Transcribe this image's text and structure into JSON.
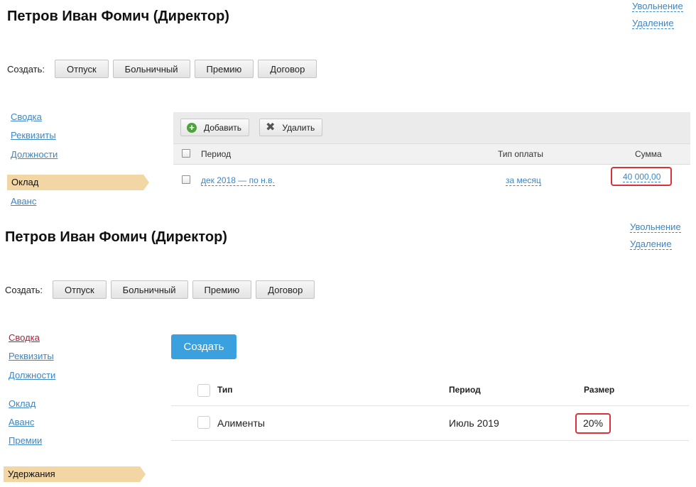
{
  "colors": {
    "accent": "#3aa0de",
    "link": "#3f86c4",
    "highlight": "#d9323b",
    "active_tab": "#f2d6a3"
  },
  "screen1": {
    "title": "Петров Иван Фомич (Директор)",
    "links": {
      "dismissal": "Увольнение",
      "delete": "Удаление"
    },
    "create": {
      "label": "Создать:",
      "buttons": [
        "Отпуск",
        "Больничный",
        "Премию",
        "Договор"
      ]
    },
    "nav": {
      "items": [
        "Сводка",
        "Реквизиты",
        "Должности"
      ],
      "active": "Оклад",
      "after": [
        "Аванс"
      ]
    },
    "toolbar": {
      "add": "Добавить",
      "delete": "Удалить"
    },
    "table": {
      "headers": {
        "period": "Период",
        "pay_type": "Тип оплаты",
        "amount": "Сумма"
      },
      "rows": [
        {
          "period": "дек 2018 — по н.в.",
          "pay_type": "за месяц",
          "amount": "40 000,00"
        }
      ]
    }
  },
  "screen2": {
    "title": "Петров Иван Фомич (Директор)",
    "links": {
      "dismissal": "Увольнение",
      "delete": "Удаление"
    },
    "create": {
      "label": "Создать:",
      "buttons": [
        "Отпуск",
        "Больничный",
        "Премию",
        "Договор"
      ]
    },
    "nav": {
      "group1": [
        "Сводка",
        "Реквизиты",
        "Должности"
      ],
      "group2": [
        "Оклад",
        "Аванс",
        "Премии"
      ],
      "active": "Удержания"
    },
    "create_button": "Создать",
    "table": {
      "headers": {
        "type": "Тип",
        "period": "Период",
        "size": "Размер"
      },
      "rows": [
        {
          "type": "Алименты",
          "period": "Июль 2019",
          "size": "20%"
        }
      ]
    }
  }
}
